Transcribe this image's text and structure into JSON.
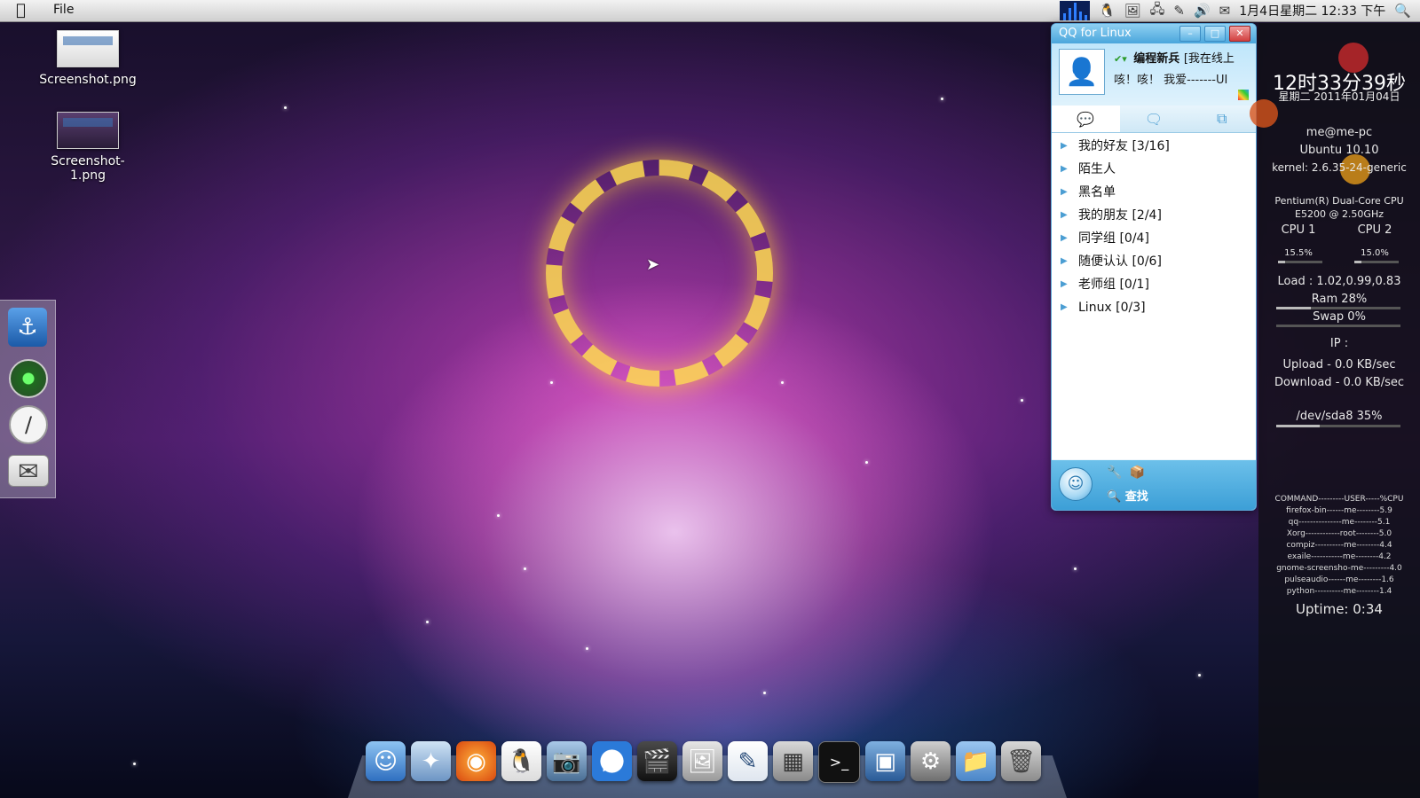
{
  "menubar": {
    "file_label": "File",
    "clock": "1月4日星期二 12:33 下午"
  },
  "desktop": {
    "icons": [
      {
        "label": "Screenshot.png"
      },
      {
        "label": "Screenshot-1.png"
      }
    ]
  },
  "qq": {
    "title": "QQ for Linux",
    "nickname": "编程新兵",
    "status_text": "[我在线上",
    "signature": "咳！咳！ 我爱-------UI",
    "groups": [
      {
        "label": "我的好友 [3/16]"
      },
      {
        "label": "陌生人"
      },
      {
        "label": "黑名单"
      },
      {
        "label": "我的朋友 [2/4]"
      },
      {
        "label": "同学组 [0/4]"
      },
      {
        "label": "随便认认 [0/6]"
      },
      {
        "label": "老师组 [0/1]"
      },
      {
        "label": "Linux [0/3]"
      }
    ],
    "find_label": "查找"
  },
  "conky": {
    "time": "12时33分39秒",
    "date": "星期二 2011年01月04日",
    "user": "me@me-pc",
    "os": "Ubuntu 10.10",
    "kernel": "kernel: 2.6.35-24-generic",
    "cpu_model_1": "Pentium(R) Dual-Core  CPU",
    "cpu_model_2": "E5200  @ 2.50GHz",
    "cpu1_label": "CPU 1",
    "cpu2_label": "CPU 2",
    "cpu1_value": "15.5%",
    "cpu2_value": "15.0%",
    "load": "Load : 1.02,0.99,0.83",
    "ram": "Ram 28%",
    "swap": "Swap 0%",
    "ip": "IP :",
    "upload": "Upload - 0.0 KB/sec",
    "download": "Download - 0.0 KB/sec",
    "disk": "/dev/sda8 35%",
    "process_header": "COMMAND---------USER-----%CPU",
    "processes": [
      "firefox-bin------me--------5.9",
      "qq---------------me--------5.1",
      "Xorg------------root--------5.0",
      "compiz----------me--------4.4",
      "exaile-----------me--------4.2",
      "gnome-screensho-me---------4.0",
      "pulseaudio------me--------1.6",
      "python----------me--------1.4"
    ],
    "uptime": "Uptime: 0:34",
    "ram_fraction": 0.28,
    "swap_fraction": 0.0,
    "disk_fraction": 0.35,
    "cpu1_fraction": 0.155,
    "cpu2_fraction": 0.15
  },
  "colors": {
    "qq_accent": "#4aa6dc",
    "conky_bg": "#0f0f14"
  },
  "icons": {
    "left_dock": [
      "anchor-icon",
      "green-orb-icon",
      "clock-icon",
      "mail-icon"
    ],
    "dock": [
      "finder-icon",
      "mail-bird-icon",
      "firefox-icon",
      "qq-penguin-icon",
      "camera-icon",
      "play-icon",
      "movie-icon",
      "photo-icon",
      "document-icon",
      "calculator-icon",
      "terminal-icon",
      "virtualbox-icon",
      "settings-icon",
      "folder-icon",
      "trash-icon"
    ]
  }
}
